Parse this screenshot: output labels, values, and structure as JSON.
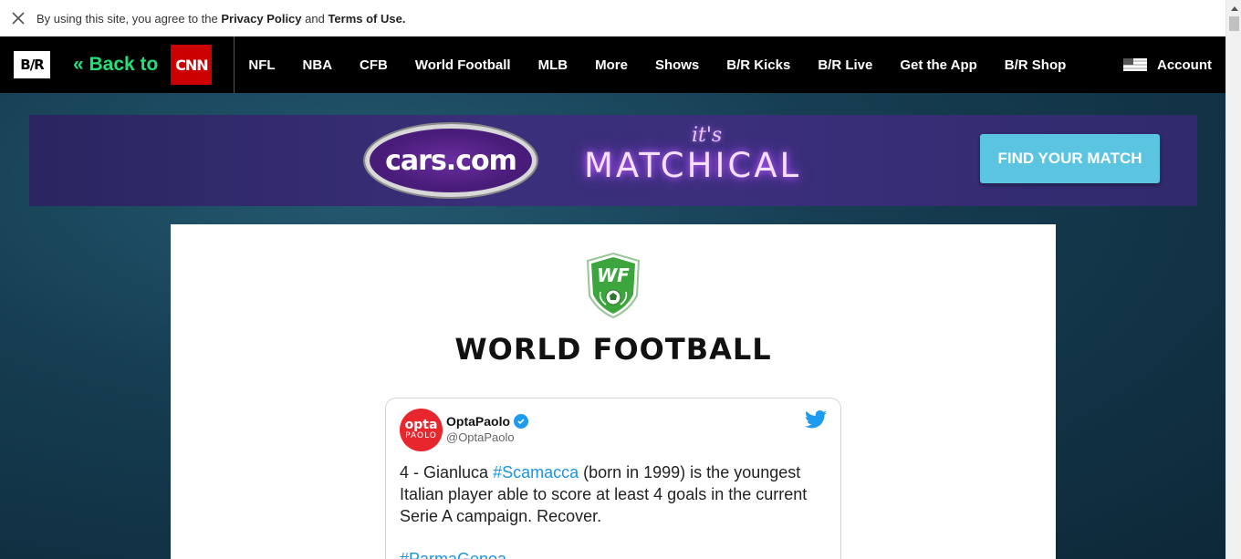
{
  "privacy_bar": {
    "prefix": "By using this site, you agree to the ",
    "privacy_link": "Privacy Policy",
    "middle": " and ",
    "terms_link": "Terms of Use."
  },
  "nav": {
    "logo": "B/R",
    "back_label": "« Back to",
    "cnn_label": "CNN",
    "items": [
      "NFL",
      "NBA",
      "CFB",
      "World Football",
      "MLB",
      "More",
      "Shows",
      "B/R Kicks",
      "B/R Live",
      "Get the App",
      "B/R Shop"
    ],
    "account_label": "Account"
  },
  "ad": {
    "brand": "cars.com",
    "tag_small": "it's",
    "tag": "MATCHICAL",
    "cta": "FIND YOUR MATCH"
  },
  "page": {
    "badge_text": "WF",
    "title": "WORLD FOOTBALL"
  },
  "tweet": {
    "avatar_top": "opta",
    "avatar_bottom": "PAOLO",
    "name": "OptaPaolo",
    "handle": "@OptaPaolo",
    "text_part1": "4 - Gianluca ",
    "hashtag1": "#Scamacca",
    "text_part2": " (born in 1999) is the youngest Italian player able to score at least 4 goals in the current Serie A campaign. Recover.",
    "hashtag2": "#ParmaGenoa"
  },
  "colors": {
    "accent_green": "#23e07a",
    "cnn_red": "#cc0000",
    "cta_blue": "#5bc4e0",
    "twitter_blue": "#1d9bf0"
  }
}
